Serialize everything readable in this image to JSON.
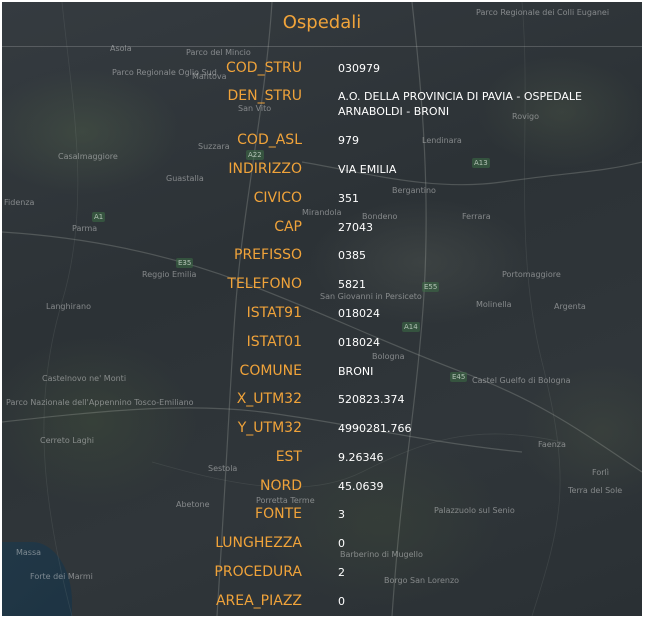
{
  "panel": {
    "title": "Ospedali"
  },
  "fields": [
    {
      "key": "COD_STRU",
      "value": "030979"
    },
    {
      "key": "DEN_STRU",
      "value": "A.O. DELLA PROVINCIA DI PAVIA - OSPEDALE ARNABOLDI - BRONI"
    },
    {
      "key": "COD_ASL",
      "value": "979"
    },
    {
      "key": "INDIRIZZO",
      "value": "VIA EMILIA"
    },
    {
      "key": "CIVICO",
      "value": "351"
    },
    {
      "key": "CAP",
      "value": "27043"
    },
    {
      "key": "PREFISSO",
      "value": "0385"
    },
    {
      "key": "TELEFONO",
      "value": "5821"
    },
    {
      "key": "ISTAT91",
      "value": "018024"
    },
    {
      "key": "ISTAT01",
      "value": "018024"
    },
    {
      "key": "COMUNE",
      "value": "BRONI"
    },
    {
      "key": "X_UTM32",
      "value": "520823.374"
    },
    {
      "key": "Y_UTM32",
      "value": "4990281.766"
    },
    {
      "key": "EST",
      "value": "9.26346"
    },
    {
      "key": "NORD",
      "value": "45.0639"
    },
    {
      "key": "FONTE",
      "value": "3"
    },
    {
      "key": "LUNGHEZZA",
      "value": "0"
    },
    {
      "key": "PROCEDURA",
      "value": "2"
    },
    {
      "key": "AREA_PIAZZ",
      "value": "0"
    }
  ],
  "map": {
    "labels": [
      "Asola",
      "Mantova",
      "Parco Regionale Oglio Sud",
      "Parco del Mincio",
      "San Vito",
      "Suzzara",
      "Casalmaggiore",
      "Guastalla",
      "Parco Regionale dei Colli Euganei",
      "Rovigo",
      "Lendinara",
      "Bondeno",
      "Mirandola",
      "Bergantino",
      "Ferrara",
      "Parma",
      "Reggio Emilia",
      "Portomaggiore",
      "Langhirano",
      "Molinella",
      "Argenta",
      "San Giovanni in Persiceto",
      "Bologna",
      "Castelnovo ne' Monti",
      "Castel Guelfo di Bologna",
      "Parco Nazionale dell'Appennino Tosco-Emiliano",
      "Cerreto Laghi",
      "Sestola",
      "Abetone",
      "Porretta Terme",
      "Faenza",
      "Forlì",
      "Terra del Sole",
      "Palazzuolo sul Senio",
      "Barberino di Mugello",
      "Borgo San Lorenzo",
      "Massa",
      "Forte dei Marmi",
      "Fidenza"
    ],
    "roads": [
      "A22",
      "A13",
      "A1",
      "E35",
      "E45",
      "A14",
      "E55"
    ]
  },
  "colors": {
    "accent": "#f0a33a",
    "value_text": "#ffffff",
    "map_base": "#2b3138"
  }
}
